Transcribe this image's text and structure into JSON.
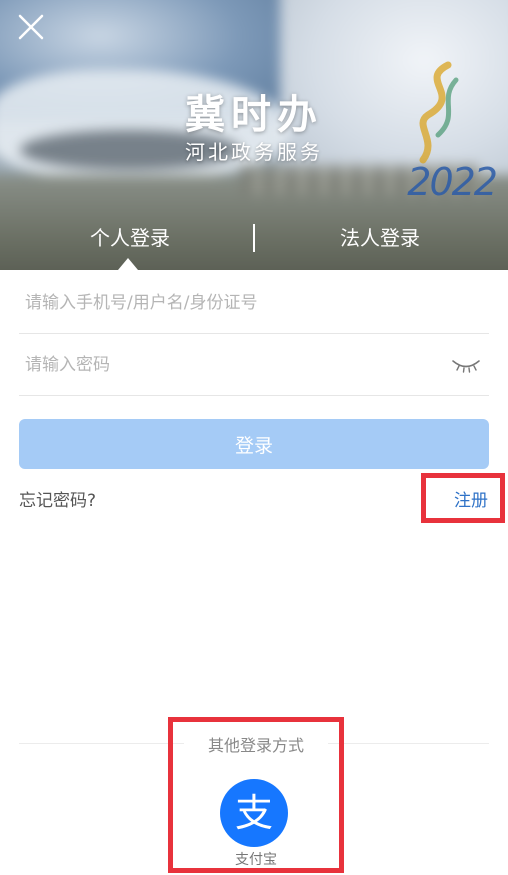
{
  "header": {
    "title": "冀时办",
    "subtitle": "河北政务服务",
    "badge_year": "2022",
    "close_icon": "close-icon"
  },
  "tabs": [
    {
      "label": "个人登录",
      "active": true
    },
    {
      "label": "法人登录",
      "active": false
    }
  ],
  "form": {
    "username_placeholder": "请输入手机号/用户名/身份证号",
    "password_placeholder": "请输入密码",
    "login_label": "登录",
    "forgot_label": "忘记密码?",
    "register_label": "注册"
  },
  "other_login": {
    "title": "其他登录方式",
    "alipay_label": "支付宝",
    "alipay_glyph": "支"
  },
  "colors": {
    "accent": "#2f72c7",
    "login_button": "#a5cbf6",
    "highlight": "#e8323c",
    "alipay": "#1677ff"
  }
}
